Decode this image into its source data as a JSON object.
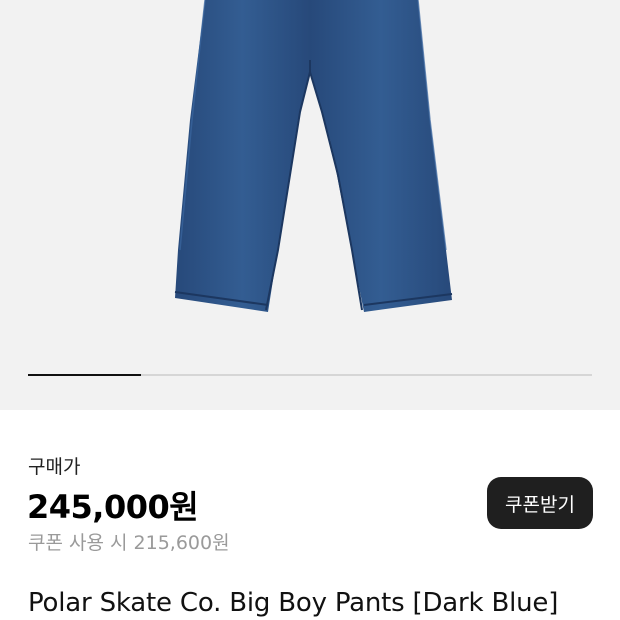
{
  "gallery": {
    "image_alt": "Polar Skate Co. Big Boy Pants [Dark Blue]",
    "progress_fraction": 0.2,
    "colors": {
      "background": "#f2f2f2",
      "denim": "#2f5688",
      "denim_dark": "#203f69",
      "track": "#d6d6d6",
      "indicator": "#111111"
    }
  },
  "pricing": {
    "label": "구매가",
    "price": "245,000원",
    "coupon_price": "쿠폰 사용 시 215,600원",
    "coupon_button_label": "쿠폰받기"
  },
  "product": {
    "name": "Polar Skate Co. Big Boy Pants [Dark Blue]"
  }
}
